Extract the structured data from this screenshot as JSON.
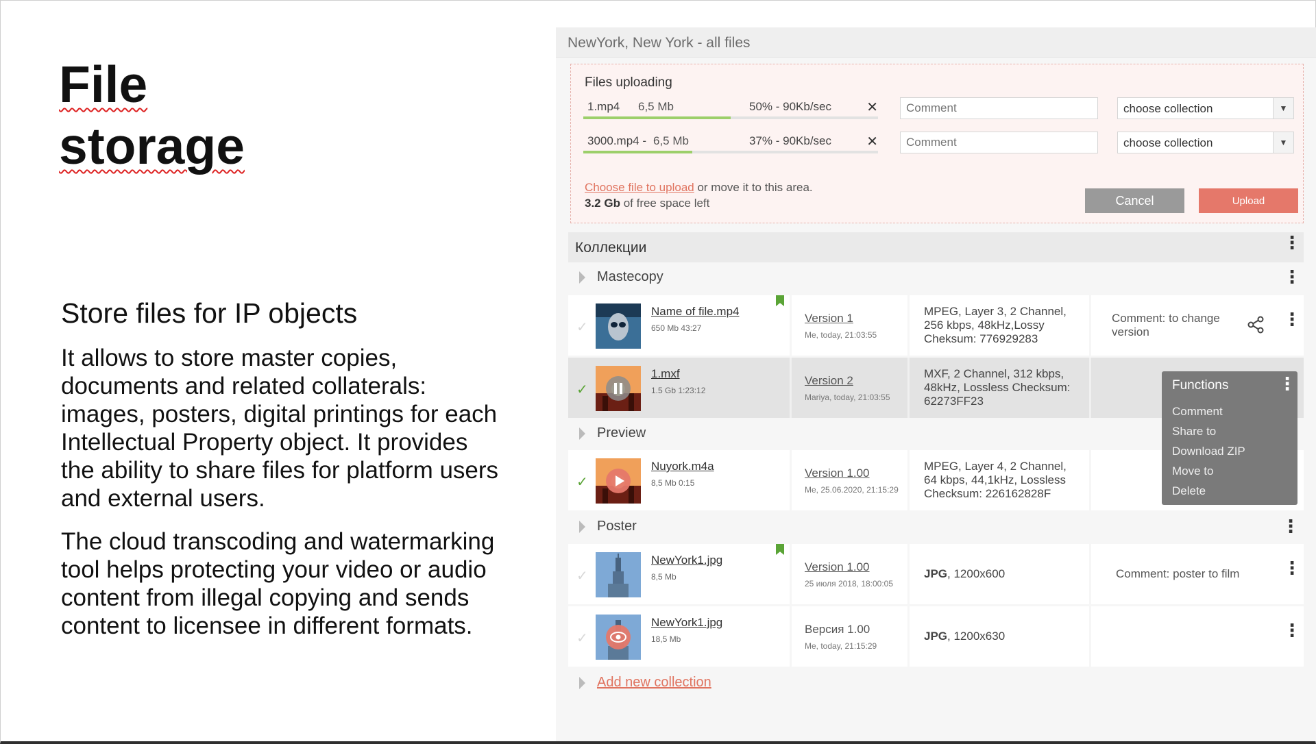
{
  "slide": {
    "title_line1": "File",
    "title_line2": "storage",
    "subtitle": "Store files for IP objects",
    "para1": "It allows to store master copies, documents and related collaterals: images, posters, digital printings for each Intellectual Property object. It provides the ability to share files for platform users and external users.",
    "para2": "The cloud transcoding and watermarking tool helps protecting your video or audio content from illegal copying and sends content to licensee in different formats."
  },
  "panel": {
    "header": "NewYork, New York - all files",
    "uploading": {
      "title": "Files uploading",
      "files": [
        {
          "name": "1.mp4",
          "size": "6,5 Mb",
          "progress": "50%  -  90Kb/sec",
          "progress_value": 0.5,
          "comment_placeholder": "Comment",
          "collection": "choose collection"
        },
        {
          "name": "3000.mp4  -",
          "size": "6,5 Mb",
          "progress": "37%  -  90Kb/sec",
          "progress_value": 0.37,
          "comment_placeholder": "Comment",
          "collection": "choose collection"
        }
      ],
      "choose_link": "Choose file to upload",
      "choose_rest": " or move it to this area.",
      "space_bold": "3.2 Gb",
      "space_rest": " of free space left",
      "cancel": "Cancel",
      "upload": "Upload"
    },
    "collections_title": "Коллекции",
    "groups": {
      "mastecopy": "Mastecopy",
      "preview": "Preview",
      "poster": "Poster",
      "add_new": "Add new collection"
    },
    "rows": [
      {
        "name": "Name of file.mp4",
        "meta": "650 Mb   43:27",
        "version": "Version 1",
        "vmeta": "Me, today, 21:03:55",
        "tech": "MPEG, Layer 3, 2 Channel, 256 kbps, 48kHz,Lossy Cheksum: 776929283",
        "comment": "Comment: to change version"
      },
      {
        "name": "1.mxf",
        "meta": "1.5 Gb    1:23:12",
        "version": "Version 2",
        "vmeta": "Mariya, today, 21:03:55",
        "tech": "MXF, 2 Channel, 312 kbps, 48kHz, Lossless Checksum: 62273FF23",
        "comment": ""
      },
      {
        "name": "Nuyork.m4a",
        "meta": "8,5 Mb     0:15",
        "version": "Version 1.00",
        "vmeta": "Me, 25.06.2020, 21:15:29",
        "tech": "MPEG, Layer 4, 2 Channel, 64 kbps, 44,1kHz, Lossless Checksum: 226162828F",
        "comment": ""
      },
      {
        "name": "NewYork1.jpg",
        "meta": "8,5 Mb",
        "version": "Version 1.00",
        "vmeta": "25 июля 2018, 18:00:05",
        "tech_bold": "JPG",
        "tech": ", 1200x600",
        "comment": "Comment: poster to film"
      },
      {
        "name": "NewYork1.jpg",
        "meta": "18,5 Mb",
        "version": "Версия 1.00",
        "vmeta": "Me, today, 21:15:29",
        "tech_bold": "JPG",
        "tech": ", 1200x630",
        "comment": ""
      }
    ],
    "menu": {
      "title": "Functions",
      "items": [
        "Comment",
        "Share to",
        "Download ZIP",
        "Move to",
        "Delete"
      ]
    }
  },
  "colors": {
    "accent": "#e5786a",
    "progress": "#9ccf6a",
    "check": "#5aa436"
  }
}
